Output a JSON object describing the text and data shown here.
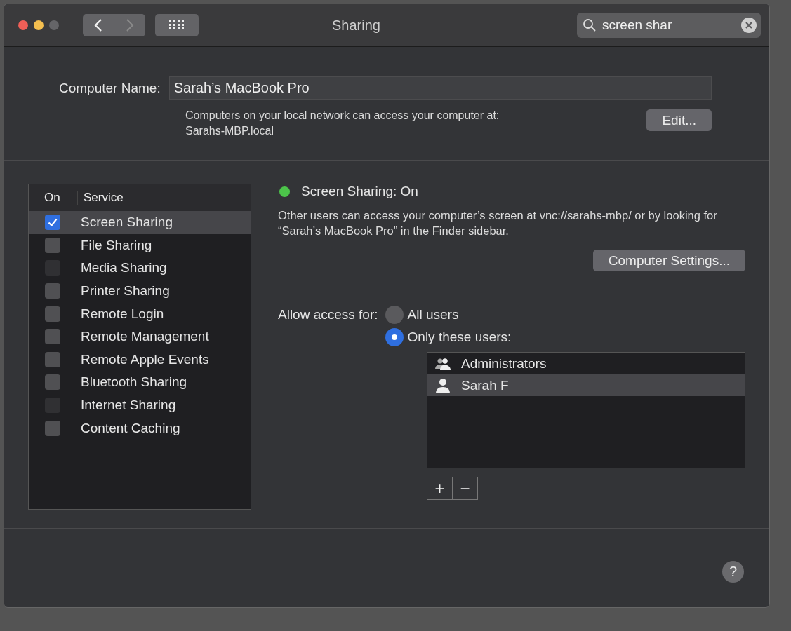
{
  "window": {
    "title": "Sharing"
  },
  "search": {
    "value": "screen shar"
  },
  "computer_name": {
    "label": "Computer Name:",
    "value": "Sarah’s MacBook Pro",
    "info": "Computers on your local network can access your computer at:",
    "address": "Sarahs-MBP.local",
    "edit_button": "Edit..."
  },
  "services": {
    "columns": [
      "On",
      "Service"
    ],
    "rows": [
      {
        "name": "Screen Sharing",
        "checked": true,
        "selected": true,
        "disabled": false
      },
      {
        "name": "File Sharing",
        "checked": false,
        "selected": false,
        "disabled": false
      },
      {
        "name": "Media Sharing",
        "checked": false,
        "selected": false,
        "disabled": true
      },
      {
        "name": "Printer Sharing",
        "checked": false,
        "selected": false,
        "disabled": false
      },
      {
        "name": "Remote Login",
        "checked": false,
        "selected": false,
        "disabled": false
      },
      {
        "name": "Remote Management",
        "checked": false,
        "selected": false,
        "disabled": false
      },
      {
        "name": "Remote Apple Events",
        "checked": false,
        "selected": false,
        "disabled": false
      },
      {
        "name": "Bluetooth Sharing",
        "checked": false,
        "selected": false,
        "disabled": false
      },
      {
        "name": "Internet Sharing",
        "checked": false,
        "selected": false,
        "disabled": true
      },
      {
        "name": "Content Caching",
        "checked": false,
        "selected": false,
        "disabled": false
      }
    ]
  },
  "detail": {
    "status": "Screen Sharing: On",
    "on": true,
    "description": "Other users can access your computer’s screen at vnc://sarahs-mbp/ or by looking for “Sarah’s MacBook Pro” in the Finder sidebar.",
    "settings_button": "Computer Settings...",
    "access_label": "Allow access for:",
    "access_options": [
      {
        "label": "All users",
        "selected": false
      },
      {
        "label": "Only these users:",
        "selected": true
      }
    ],
    "users": [
      {
        "name": "Administrators",
        "kind": "group",
        "selected": false
      },
      {
        "name": "Sarah F",
        "kind": "user",
        "selected": true
      }
    ],
    "add_button": "+",
    "remove_button": "−"
  },
  "help_button": "?"
}
